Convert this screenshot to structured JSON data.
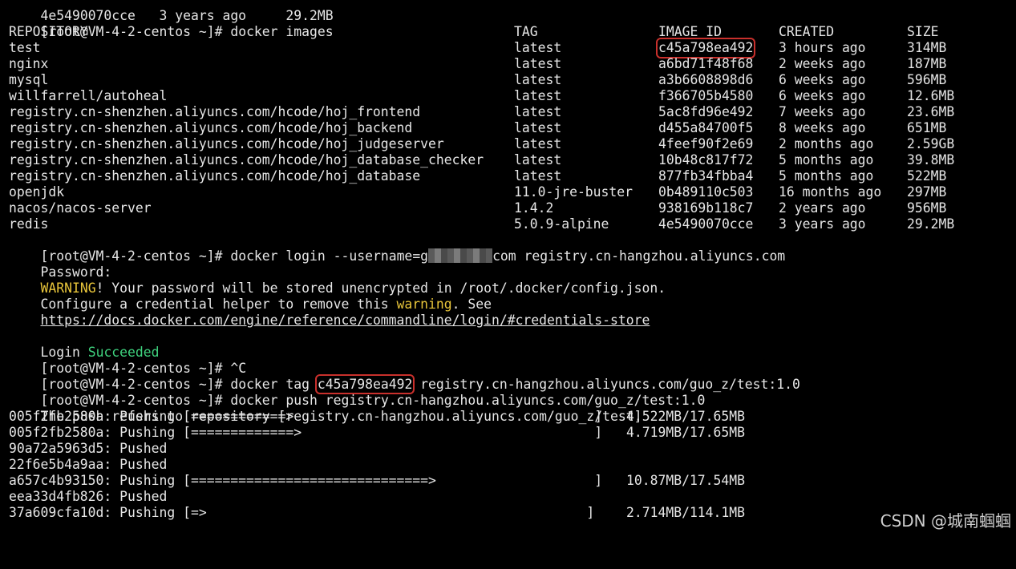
{
  "prompt": "[root@VM-4-2-centos ~]# ",
  "cut_line": "4e5490070cce   3 years ago     29.2MB",
  "cmd_images": "docker images",
  "table": {
    "headers": {
      "repository": "REPOSITORY",
      "tag": "TAG",
      "image_id": "IMAGE ID",
      "created": "CREATED",
      "size": "SIZE"
    },
    "rows": [
      {
        "repository": "test",
        "tag": "latest",
        "image_id": "c45a798ea492",
        "created": "3 hours ago",
        "size": "314MB"
      },
      {
        "repository": "nginx",
        "tag": "latest",
        "image_id": "a6bd71f48f68",
        "created": "2 weeks ago",
        "size": "187MB"
      },
      {
        "repository": "mysql",
        "tag": "latest",
        "image_id": "a3b6608898d6",
        "created": "6 weeks ago",
        "size": "596MB"
      },
      {
        "repository": "willfarrell/autoheal",
        "tag": "latest",
        "image_id": "f366705b4580",
        "created": "6 weeks ago",
        "size": "12.6MB"
      },
      {
        "repository": "registry.cn-shenzhen.aliyuncs.com/hcode/hoj_frontend",
        "tag": "latest",
        "image_id": "5ac8fd96e492",
        "created": "7 weeks ago",
        "size": "23.6MB"
      },
      {
        "repository": "registry.cn-shenzhen.aliyuncs.com/hcode/hoj_backend",
        "tag": "latest",
        "image_id": "d455a84700f5",
        "created": "8 weeks ago",
        "size": "651MB"
      },
      {
        "repository": "registry.cn-shenzhen.aliyuncs.com/hcode/hoj_judgeserver",
        "tag": "latest",
        "image_id": "4feef90f2e69",
        "created": "2 months ago",
        "size": "2.59GB"
      },
      {
        "repository": "registry.cn-shenzhen.aliyuncs.com/hcode/hoj_database_checker",
        "tag": "latest",
        "image_id": "10b48c817f72",
        "created": "5 months ago",
        "size": "39.8MB"
      },
      {
        "repository": "registry.cn-shenzhen.aliyuncs.com/hcode/hoj_database",
        "tag": "latest",
        "image_id": "877fb34fbba4",
        "created": "5 months ago",
        "size": "522MB"
      },
      {
        "repository": "openjdk",
        "tag": "11.0-jre-buster",
        "image_id": "0b489110c503",
        "created": "16 months ago",
        "size": "297MB"
      },
      {
        "repository": "nacos/nacos-server",
        "tag": "1.4.2",
        "image_id": "938169b118c7",
        "created": "2 years ago",
        "size": "956MB"
      },
      {
        "repository": "redis",
        "tag": "5.0.9-alpine",
        "image_id": "4e5490070cce",
        "created": "3 years ago",
        "size": "29.2MB"
      }
    ]
  },
  "login": {
    "cmd": "docker login ",
    "flag": "--username",
    "eq": "=g",
    "after_redact": "com registry.cn-hangzhou.aliyuncs.com",
    "password": "Password:",
    "warning_word": "WARNING",
    "warning_rest": "! Your password will be stored unencrypted in /root/.docker/config.json.",
    "configure_a": "Configure a credential helper to remove this ",
    "configure_warning": "warning",
    "configure_b": ". See",
    "url": "https://docs.docker.com/engine/reference/commandline/login/#credentials-store",
    "login_word": "Login ",
    "succeeded": "Succeeded"
  },
  "ctrl_c": "^C",
  "tag_cmd": {
    "prefix": "docker tag ",
    "image_id": "c45a798ea492",
    "target": " registry.cn-hangzhou.aliyuncs.com/guo_z/test:1.0"
  },
  "push_cmd": "docker push registry.cn-hangzhou.aliyuncs.com/guo_z/test:1.0",
  "push_refers": "The push refers to repository [registry.cn-hangzhou.aliyuncs.com/guo_z/test]",
  "push_layers": [
    {
      "text": "005f2fb2580a: Pushing [============>                                      ]",
      "size": "4.522MB/17.65MB"
    },
    {
      "text": "005f2fb2580a: Pushing [=============>                                     ]",
      "size": "4.719MB/17.65MB"
    },
    {
      "text": "90a72a5963d5: Pushed",
      "size": ""
    },
    {
      "text": "22f6e5b4a9aa: Pushed",
      "size": ""
    },
    {
      "text": "a657c4b93150: Pushing [==============================>                    ]",
      "size": "10.87MB/17.54MB"
    },
    {
      "text": "eea33d4fb826: Pushed",
      "size": ""
    },
    {
      "text": "37a609cfa10d: Pushing [=>                                                ]",
      "size": "2.714MB/114.1MB"
    }
  ],
  "watermark": "CSDN @城南蝈蝈"
}
